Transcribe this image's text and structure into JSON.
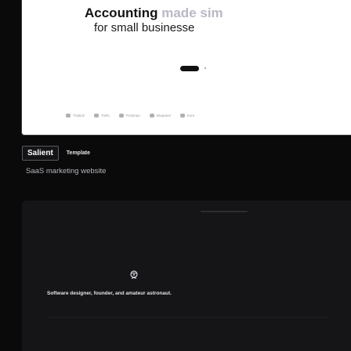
{
  "hero": {
    "title_main": "Accounting",
    "title_faded": "made sim",
    "subtitle": "for small businesse",
    "logos": [
      "Ticktick",
      "Trello",
      "Postman",
      "Mixpanel",
      "Kore"
    ]
  },
  "template": {
    "name": "Salient",
    "tag": "Template",
    "description": "SaaS marketing website"
  },
  "testimonial": {
    "bio": "Software designer, founder, and amateur astronaut."
  },
  "colors": {
    "background": "#0a0a0b",
    "preview_bg": "#ffffff",
    "card_bg": "#151518",
    "muted_text": "#b5b5bb"
  }
}
